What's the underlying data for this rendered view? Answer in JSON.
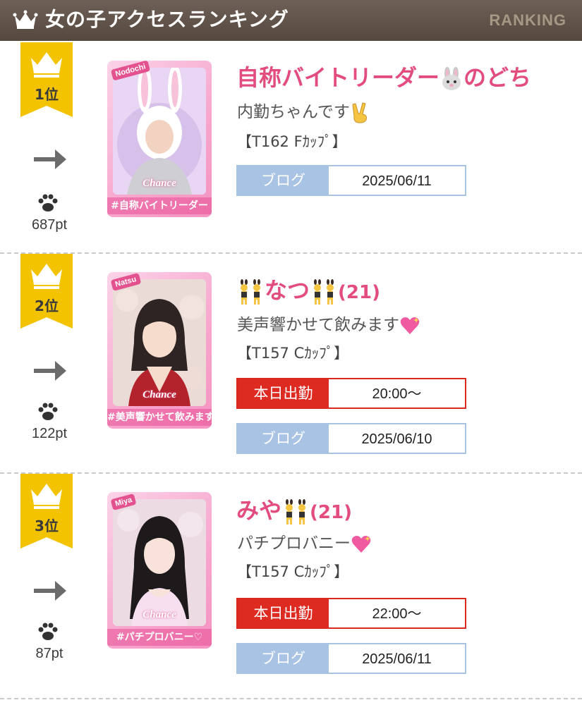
{
  "header": {
    "title": "女の子アクセスランキング",
    "en": "RANKING"
  },
  "entries": [
    {
      "rank": "1位",
      "points": "687pt",
      "card_tag": "Nodochi",
      "card_brand": "Chance",
      "card_caption": "#自称バイトリーダー",
      "name": "自称バイトリーダー",
      "name2": "のどち",
      "age": "",
      "comment": "内勤ちゃんです",
      "size": "【T162 Fｶｯﾌﾟ】",
      "work_label": "",
      "work_time": "",
      "blog_label": "ブログ",
      "blog_date": "2025/06/11",
      "icons": [
        "rabbit-emoji-icon",
        "victory-hand-emoji-icon"
      ]
    },
    {
      "rank": "2位",
      "points": "122pt",
      "card_tag": "Natsu",
      "card_brand": "Chance",
      "card_caption": "#美声響かせて飲みます",
      "name": "なつ",
      "name2": "",
      "age": "(21)",
      "comment": "美声響かせて飲みます",
      "size": "【T157 Cｶｯﾌﾟ】",
      "work_label": "本日出勤",
      "work_time": "20:00～",
      "blog_label": "ブログ",
      "blog_date": "2025/06/10",
      "icons": [
        "bunny-girls-emoji-icon",
        "sparkling-heart-icon"
      ]
    },
    {
      "rank": "3位",
      "points": "87pt",
      "card_tag": "Miya",
      "card_brand": "Chance",
      "card_caption": "#パチプロバニー♡",
      "name": "みや",
      "name2": "",
      "age": "(21)",
      "comment": "パチプロバニー",
      "size": "【T157 Cｶｯﾌﾟ】",
      "work_label": "本日出勤",
      "work_time": "22:00～",
      "blog_label": "ブログ",
      "blog_date": "2025/06/11",
      "icons": [
        "bunny-girls-emoji-icon",
        "sparkling-heart-icon"
      ]
    }
  ],
  "colors": {
    "header_bg": "#5f5249",
    "name": "#e24d7d",
    "badge": "#f4c300",
    "blog": "#a8c3e3",
    "work": "#de2b22"
  }
}
